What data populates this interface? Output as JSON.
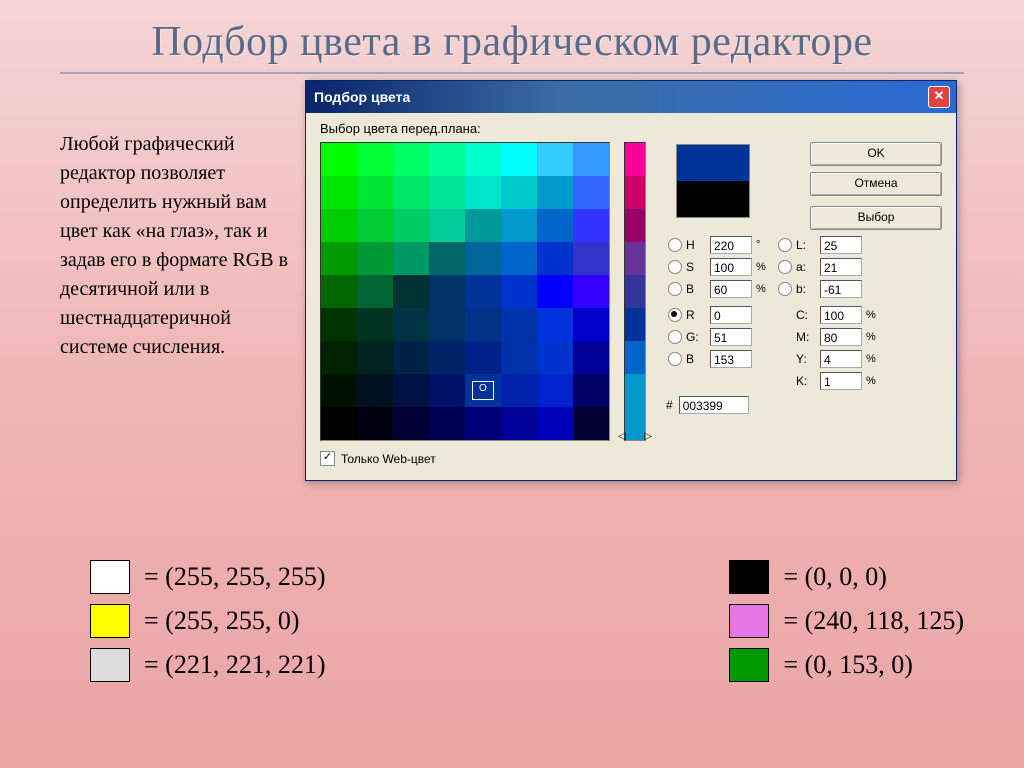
{
  "title": "Подбор цвета в графическом редакторе",
  "description": "Любой графический редактор позволяет определить нужный вам цвет как «на глаз»,\nтак и задав его в формате\nRGB в десятичной или в шестнадцатеричной системе счисления.",
  "dialog": {
    "title": "Подбор цвета",
    "prompt": "Выбор цвета перед.плана:",
    "buttons": {
      "ok": "OK",
      "cancel": "Отмена",
      "select": "Выбор"
    },
    "hsb": {
      "H": "220",
      "H_unit": "°",
      "S": "100",
      "S_unit": "%",
      "B": "60",
      "B_unit": "%"
    },
    "lab": {
      "L": "25",
      "a": "21",
      "b": "-61"
    },
    "rgb": {
      "R": "0",
      "G": "51",
      "B": "153"
    },
    "cmyk": {
      "C": "100",
      "C_unit": "%",
      "M": "80",
      "M_unit": "%",
      "Y": "4",
      "Y_unit": "%",
      "K": "1",
      "K_unit": "%"
    },
    "labels": {
      "H": "H",
      "S": "S",
      "B": "B",
      "L": "L:",
      "a": "a:",
      "b": "b:",
      "R": "R",
      "G": "G:",
      "Bv": "B",
      "C": "C:",
      "M": "M:",
      "Y": "Y:",
      "K": "K:",
      "hash": "#"
    },
    "hex": "003399",
    "web_only": "Только Web-цвет"
  },
  "legend": {
    "left": [
      {
        "color": "#ffffff",
        "text": "= (255, 255, 255)"
      },
      {
        "color": "#ffff00",
        "text": "= (255, 255, 0)"
      },
      {
        "color": "#dddddd",
        "text": "= (221, 221, 221)"
      }
    ],
    "right": [
      {
        "color": "#000000",
        "text": "= (0, 0, 0)"
      },
      {
        "color": "#e676e6",
        "text": "= (240, 118, 125)"
      },
      {
        "color": "#009900",
        "text": "= (0, 153, 0)"
      }
    ]
  }
}
